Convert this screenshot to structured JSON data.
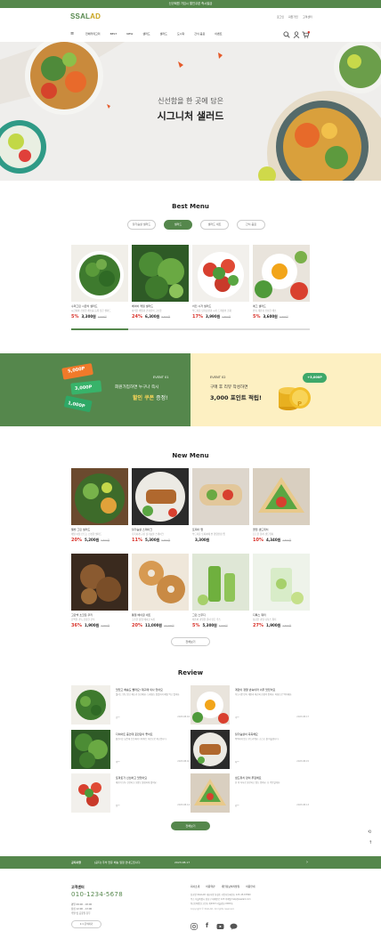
{
  "topbar": {
    "text": "신규회원 가입시 할인쿠폰 즉시발급"
  },
  "header": {
    "logo_main": "SSAL",
    "logo_accent": "AD",
    "util": [
      "로그인",
      "회원가입",
      "고객센터"
    ],
    "nav": [
      "전체카테고리",
      "BEST",
      "NEW",
      "샐러드",
      "샐러드",
      "도시락",
      "간식·음료",
      "이벤트"
    ]
  },
  "hero": {
    "line1": "신선함을 한 곳에 담은",
    "line2": "시그니처 샐러드"
  },
  "best": {
    "title": "Best Menu",
    "tabs": [
      "닭가슴살 샐러드",
      "샐러드",
      "샐러드 세트",
      "간식·음료"
    ],
    "items": [
      {
        "name": "수퍼그린 시금치 샐러드",
        "desc": "시금치와 신선한 채소를 듬뿍 담은 샐러드",
        "pct": "5%",
        "price": "3,300원",
        "orig": "3,500원"
      },
      {
        "name": "베이비 케일 샐러드",
        "desc": "아삭한 케일과 견과류의 고소함",
        "pct": "24%",
        "price": "6,300원",
        "orig": "8,300원"
      },
      {
        "name": "치킨 시저 샐러드",
        "desc": "부드러운 닭가슴살과 시저 드레싱의 조화",
        "pct": "17%",
        "price": "3,990원",
        "orig": "4,800원"
      },
      {
        "name": "에그 샐러드",
        "desc": "반숙 계란과 신선한 채소",
        "pct": "5%",
        "price": "3,600원",
        "orig": "3,800원"
      }
    ]
  },
  "events": {
    "e1": {
      "label": "EVENT 01",
      "line1": "회원가입하면 누구나 즉시",
      "line2_strong": "할인 쿠폰",
      "line2_rest": " 증정!",
      "coupons": [
        "5,000P",
        "3,000P",
        "1,000P"
      ]
    },
    "e2": {
      "label": "EVENT 02",
      "line1": "구매 후 리뷰 작성하면",
      "line2": "3,000 포인트 적립!",
      "badge": "+3,000P",
      "coin": "P"
    }
  },
  "newmenu": {
    "title": "New Menu",
    "items": [
      {
        "name": "웰빙 그린 샐러드",
        "desc": "매일 아침 만드는 신선한 샐러드",
        "pct": "20%",
        "price": "5,200원",
        "orig": "6,500원"
      },
      {
        "name": "닭가슴살 스테이크",
        "desc": "촉촉하게 구운 닭가슴살 스테이크",
        "pct": "11%",
        "price": "5,300원",
        "orig": "5,950원"
      },
      {
        "name": "또띠아 랩",
        "desc": "부드러운 또띠아에 싼 영양만점 랩",
        "pct": "",
        "price": "3,300원",
        "orig": ""
      },
      {
        "name": "클럽 샌드위치",
        "desc": "든든한 한끼 샌드위치",
        "pct": "10%",
        "price": "4,340원",
        "orig": "4,800원"
      },
      {
        "name": "고단백 초코칩 쿠키",
        "desc": "단백질 가득 건강한 간식",
        "pct": "36%",
        "price": "1,900원",
        "orig": "3,000원"
      },
      {
        "name": "통밀 베이글 세트",
        "desc": "고소한 통밀 베이글 5개",
        "pct": "20%",
        "price": "11,000원",
        "orig": "14,000원"
      },
      {
        "name": "그린 스무디",
        "desc": "채소와 과일을 갈아 만든 주스",
        "pct": "5%",
        "price": "5,300원",
        "orig": "5,600원"
      },
      {
        "name": "디톡스 워터",
        "desc": "상큼한 과일 디톡스 워터",
        "pct": "27%",
        "price": "1,900원",
        "orig": "2,600원"
      }
    ],
    "more": "전체보기"
  },
  "review": {
    "title": "Review",
    "items": [
      {
        "title": "맛있고 배송도 빨라요! 재구매 의사 있어요",
        "desc": "샐러드 양도 많고 채소가 신선해요. 드레싱도 맛있어서 매일 먹고 있어요.",
        "user": "김**",
        "date": "2023.08.16"
      },
      {
        "title": "계란이 정말 반숙이라 너무 맛있어요",
        "desc": "부드러운 반숙 계란과 채소의 조합이 좋아요. 아침으로 딱이에요.",
        "user": "이**",
        "date": "2023.08.17"
      },
      {
        "title": "다이어트 중인데 포만감이 좋아요",
        "desc": "칼로리는 낮은데 든든해서 다이어트 식단으로 최고입니다.",
        "user": "박**",
        "date": "2023.08.16"
      },
      {
        "title": "닭가슴살이 촉촉해요",
        "desc": "퍽퍽하지 않고 부드러워요. 소스도 잘 어울립니다.",
        "user": "최**",
        "date": "2023.08.15"
      },
      {
        "title": "토마토가 신선하고 맛있어요",
        "desc": "재료가 모두 신선하고 포장도 깔끔하게 왔어요.",
        "user": "정**",
        "date": "2023.08.14"
      },
      {
        "title": "샌드위치 양이 푸짐해요",
        "desc": "한 끼 식사로 충분하고 맛도 좋아요. 또 주문할게요.",
        "user": "강**",
        "date": "2023.08.13"
      }
    ],
    "more": "전체보기"
  },
  "notice": {
    "label": "공지사항",
    "text": "[공지] 추석 연휴 배송 일정 안내드립니다.",
    "date": "2023.08.17",
    "arrow": "›"
  },
  "footer": {
    "cs_title": "고객센터",
    "phone": "010-1234-5678",
    "hours": [
      "평일 09:00 - 18:00",
      "점심 12:00 - 13:00",
      "주말 및 공휴일 휴무"
    ],
    "cs_button": "1:1 문의하기",
    "links": [
      "회사소개",
      "이용약관",
      "개인정보처리방침",
      "이용안내"
    ],
    "info": [
      "상호명 SSALAD  대표자명 홍길동  사업자등록번호 123-45-67890",
      "주소 서울특별시 강남구 테헤란로 123  이메일 help@ssalad.com",
      "통신판매업신고번호 제2023-서울강남-0000호"
    ],
    "copyright": "Copyright © SSALAD. All rights reserved.",
    "sns": [
      "instagram-icon",
      "facebook-icon",
      "youtube-icon",
      "kakao-icon"
    ]
  },
  "colors": {
    "brand": "#55874c",
    "accent": "#c8a21a",
    "sale": "#d8322a"
  }
}
